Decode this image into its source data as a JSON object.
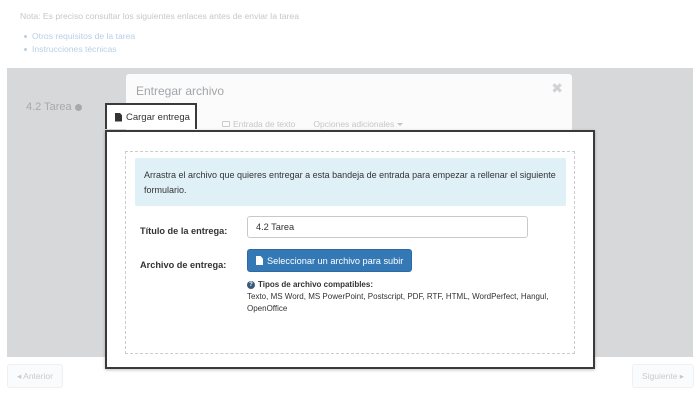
{
  "background": {
    "note": "Nota: Es preciso consultar los siguientes enlaces antes de enviar la tarea",
    "links": [
      "Otros requisitos de la tarea",
      "Instrucciones técnicas"
    ],
    "task_title": "4.2 Tarea",
    "prev_button": "◂ Anterior",
    "next_button": "Siguiente ▸"
  },
  "modal": {
    "title": "Entregar archivo",
    "close_glyph": "✖",
    "tabs": [
      "Entrada de texto",
      "Opciones adicionales"
    ],
    "active_tab": "Cargar entrega"
  },
  "form": {
    "info_text": "Arrastra el archivo que quieres entregar a esta bandeja de entrada para empezar a rellenar el siguiente formulario.",
    "title_label": "Título de la entrega:",
    "title_value": "4.2 Tarea",
    "file_label": "Archivo de entrega:",
    "upload_button": "Seleccionar un archivo para subir",
    "types_title": "Tipos de archivo compatibles:",
    "types_list": "Texto, MS Word, MS PowerPoint, Postscript, PDF, RTF, HTML, WordPerfect, Hangul, OpenOffice"
  },
  "colors": {
    "primary_button": "#3479b6",
    "info_background": "#dff0f7",
    "callout_border": "#3a3a3a"
  }
}
